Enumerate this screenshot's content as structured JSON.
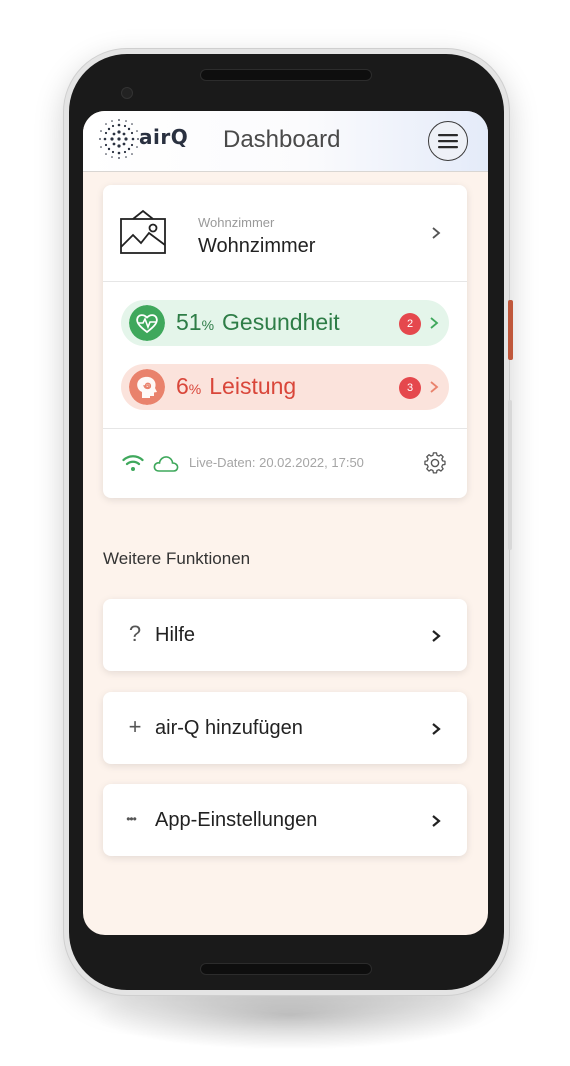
{
  "header": {
    "logo_text": "airQ",
    "title": "Dashboard",
    "menu_icon": "hamburger-menu-icon"
  },
  "device": {
    "room_subtitle": "Wohnzimmer",
    "room_name": "Wohnzimmer",
    "room_icon": "picture-frame-icon",
    "metrics": [
      {
        "value": "51",
        "unit": "%",
        "label": "Gesundheit",
        "badge": "2",
        "icon": "heart-pulse-icon",
        "color": "#2e7d47",
        "accent": "#3fa85c"
      },
      {
        "value": "6",
        "unit": "%",
        "label": "Leistung",
        "badge": "3",
        "icon": "spiral-head-icon",
        "color": "#d9463a",
        "accent": "#e9826c"
      }
    ],
    "status": {
      "wifi_icon": "wifi-icon",
      "cloud_icon": "cloud-icon",
      "live_text": "Live-Daten: 20.02.2022, 17:50",
      "settings_icon": "gear-icon"
    }
  },
  "functions": {
    "title": "Weitere Funktionen",
    "items": [
      {
        "icon": "?",
        "label": "Hilfe"
      },
      {
        "icon": "+",
        "label": "air-Q hinzufügen"
      },
      {
        "icon": "•••",
        "label": "App-Einstellungen"
      }
    ]
  },
  "colors": {
    "badge": "#e5484d",
    "screen_bg": "#fdf3ec",
    "green": "#3fa85c",
    "red": "#e9826c"
  }
}
